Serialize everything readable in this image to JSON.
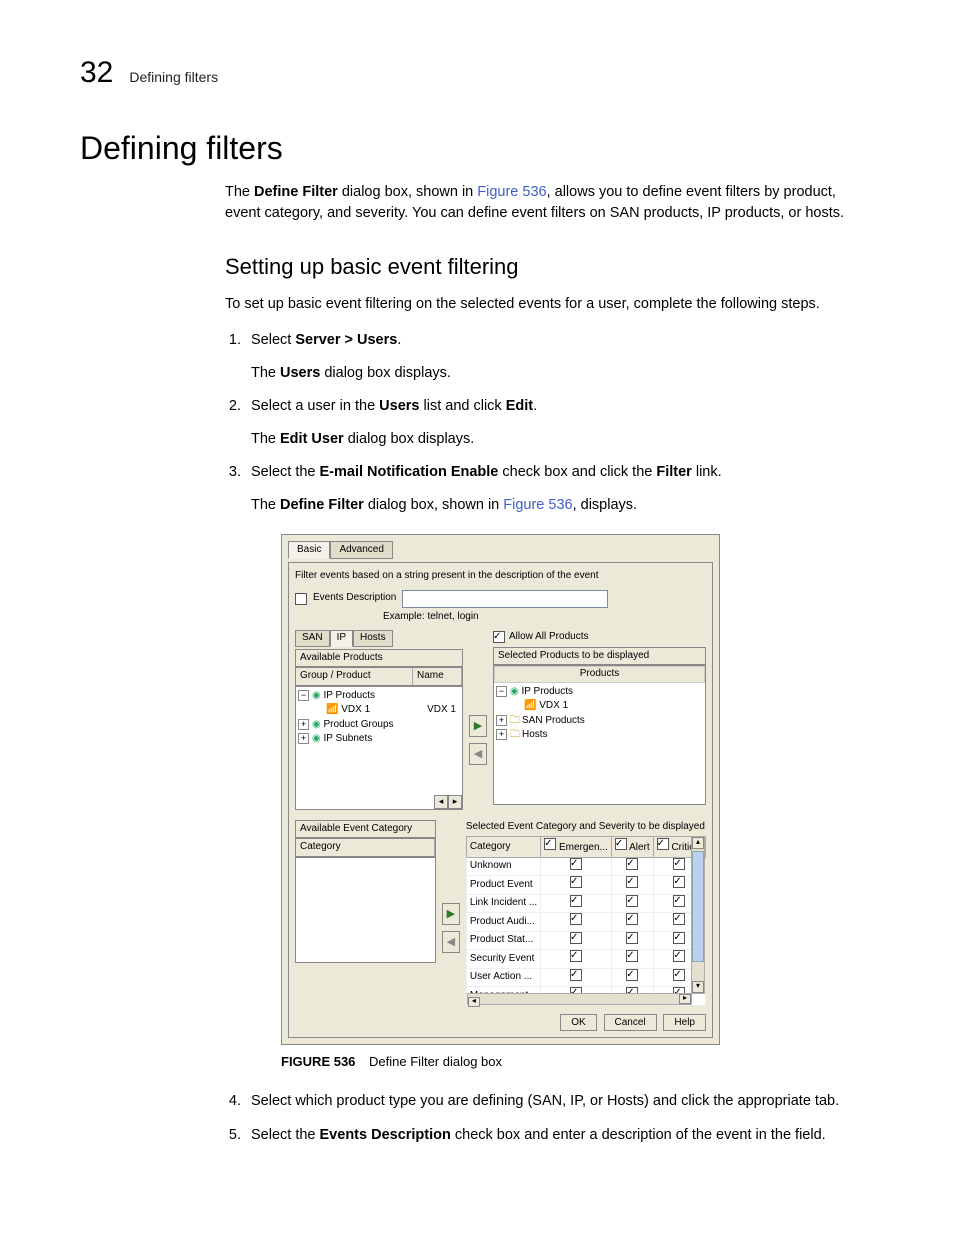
{
  "header": {
    "chapter_number": "32",
    "chapter_title": "Defining filters"
  },
  "h1": "Defining filters",
  "intro_pre": "The ",
  "intro_bold": "Define Filter",
  "intro_mid": " dialog box, shown in ",
  "intro_link": "Figure 536",
  "intro_post": ", allows you to define event filters by product, event category, and severity. You can define event filters on SAN products, IP products, or hosts.",
  "h2": "Setting up basic event filtering",
  "lead": "To set up basic event filtering on the selected events for a user, complete the following steps.",
  "steps": {
    "s1": {
      "pre": "Select ",
      "bold": "Server > Users",
      "post": ".",
      "sub_pre": "The ",
      "sub_bold": "Users",
      "sub_post": " dialog box displays."
    },
    "s2": {
      "pre": "Select a user in the ",
      "bold": "Users",
      "mid": " list and click ",
      "bold2": "Edit",
      "post": ".",
      "sub_pre": "The ",
      "sub_bold": "Edit User",
      "sub_post": " dialog box displays."
    },
    "s3": {
      "pre": "Select the ",
      "bold": "E-mail Notification Enable",
      "mid": " check box and click the ",
      "bold2": "Filter",
      "post": " link.",
      "sub_pre": "The ",
      "sub_bold": "Define Filter",
      "sub_mid": " dialog box, shown in ",
      "sub_link": "Figure 536",
      "sub_post": ", displays."
    },
    "s4": "Select which product type you are defining (SAN, IP, or Hosts) and click the appropriate tab.",
    "s5": {
      "pre": "Select the ",
      "bold": "Events Description",
      "post": " check box and enter a description of the event in the field."
    }
  },
  "dialog": {
    "tabs": {
      "basic": "Basic",
      "advanced": "Advanced"
    },
    "filter_intro": "Filter events based on a string present in the description of the event",
    "events_desc_label": "Events Description",
    "example_label": "Example: telnet, login",
    "prod_tabs": {
      "san": "SAN",
      "ip": "IP",
      "hosts": "Hosts"
    },
    "available_products": "Available Products",
    "group_product": "Group / Product",
    "name_col": "Name",
    "tree": {
      "ip_products": "IP Products",
      "vdx1": "VDX 1",
      "vdx1_name": "VDX 1",
      "product_groups": "Product Groups",
      "ip_subnets": "IP Subnets"
    },
    "allow_all": "Allow All Products",
    "selected_products_head": "Selected Products to be displayed",
    "products_col": "Products",
    "sel_tree": {
      "ip_products": "IP Products",
      "vdx1": "VDX 1",
      "san_products": "SAN Products",
      "hosts": "Hosts"
    },
    "available_cat": "Available Event Category",
    "category_col": "Category",
    "selected_cat_head": "Selected Event Category and Severity to be displayed",
    "sev_cols": {
      "category": "Category",
      "emergency": "Emergen...",
      "alert": "Alert",
      "critical": "Critical"
    },
    "cat_rows": [
      "Unknown",
      "Product Event",
      "Link Incident ...",
      "Product Audi...",
      "Product Stat...",
      "Security Event",
      "User Action ...",
      "Management..."
    ],
    "buttons": {
      "ok": "OK",
      "cancel": "Cancel",
      "help": "Help"
    }
  },
  "figure": {
    "label": "FIGURE 536",
    "caption": "Define Filter dialog box"
  }
}
